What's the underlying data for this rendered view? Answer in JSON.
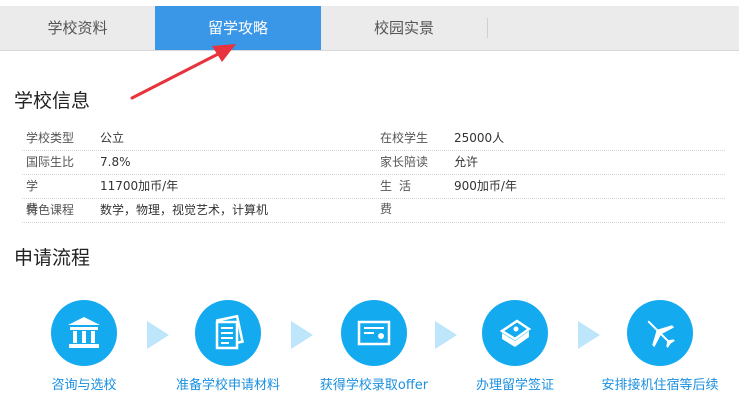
{
  "tabs": [
    {
      "label": "学校资料",
      "active": false
    },
    {
      "label": "留学攻略",
      "active": true
    },
    {
      "label": "校园实景",
      "active": false
    }
  ],
  "school_info": {
    "title": "学校信息",
    "rows": [
      {
        "l1": "学校类型",
        "v1": "公立",
        "l2": "在校学生",
        "v2": "25000人"
      },
      {
        "l1": "国际生比",
        "v1": "7.8%",
        "l2": "家长陪读",
        "v2": "允许"
      },
      {
        "l1": "学费",
        "v1": "11700加币/年",
        "l2": "生活费",
        "v2": "900加币/年"
      },
      {
        "l1": "特色课程",
        "v1": "数学，物理，视觉艺术，计算机",
        "l2": "",
        "v2": ""
      }
    ]
  },
  "process": {
    "title": "申请流程",
    "steps": [
      {
        "label": "咨询与选校",
        "icon": "building-icon"
      },
      {
        "label": "准备学校申请材料",
        "icon": "documents-icon"
      },
      {
        "label": "获得学校录取offer",
        "icon": "certificate-icon"
      },
      {
        "label": "办理留学签证",
        "icon": "passport-icon"
      },
      {
        "label": "安排接机住宿等后续",
        "icon": "airplane-icon"
      }
    ]
  },
  "colors": {
    "accent": "#3a96e6",
    "step_circle": "#14aaf0",
    "arrow": "#e8323c",
    "chevron": "#bde6fb"
  }
}
